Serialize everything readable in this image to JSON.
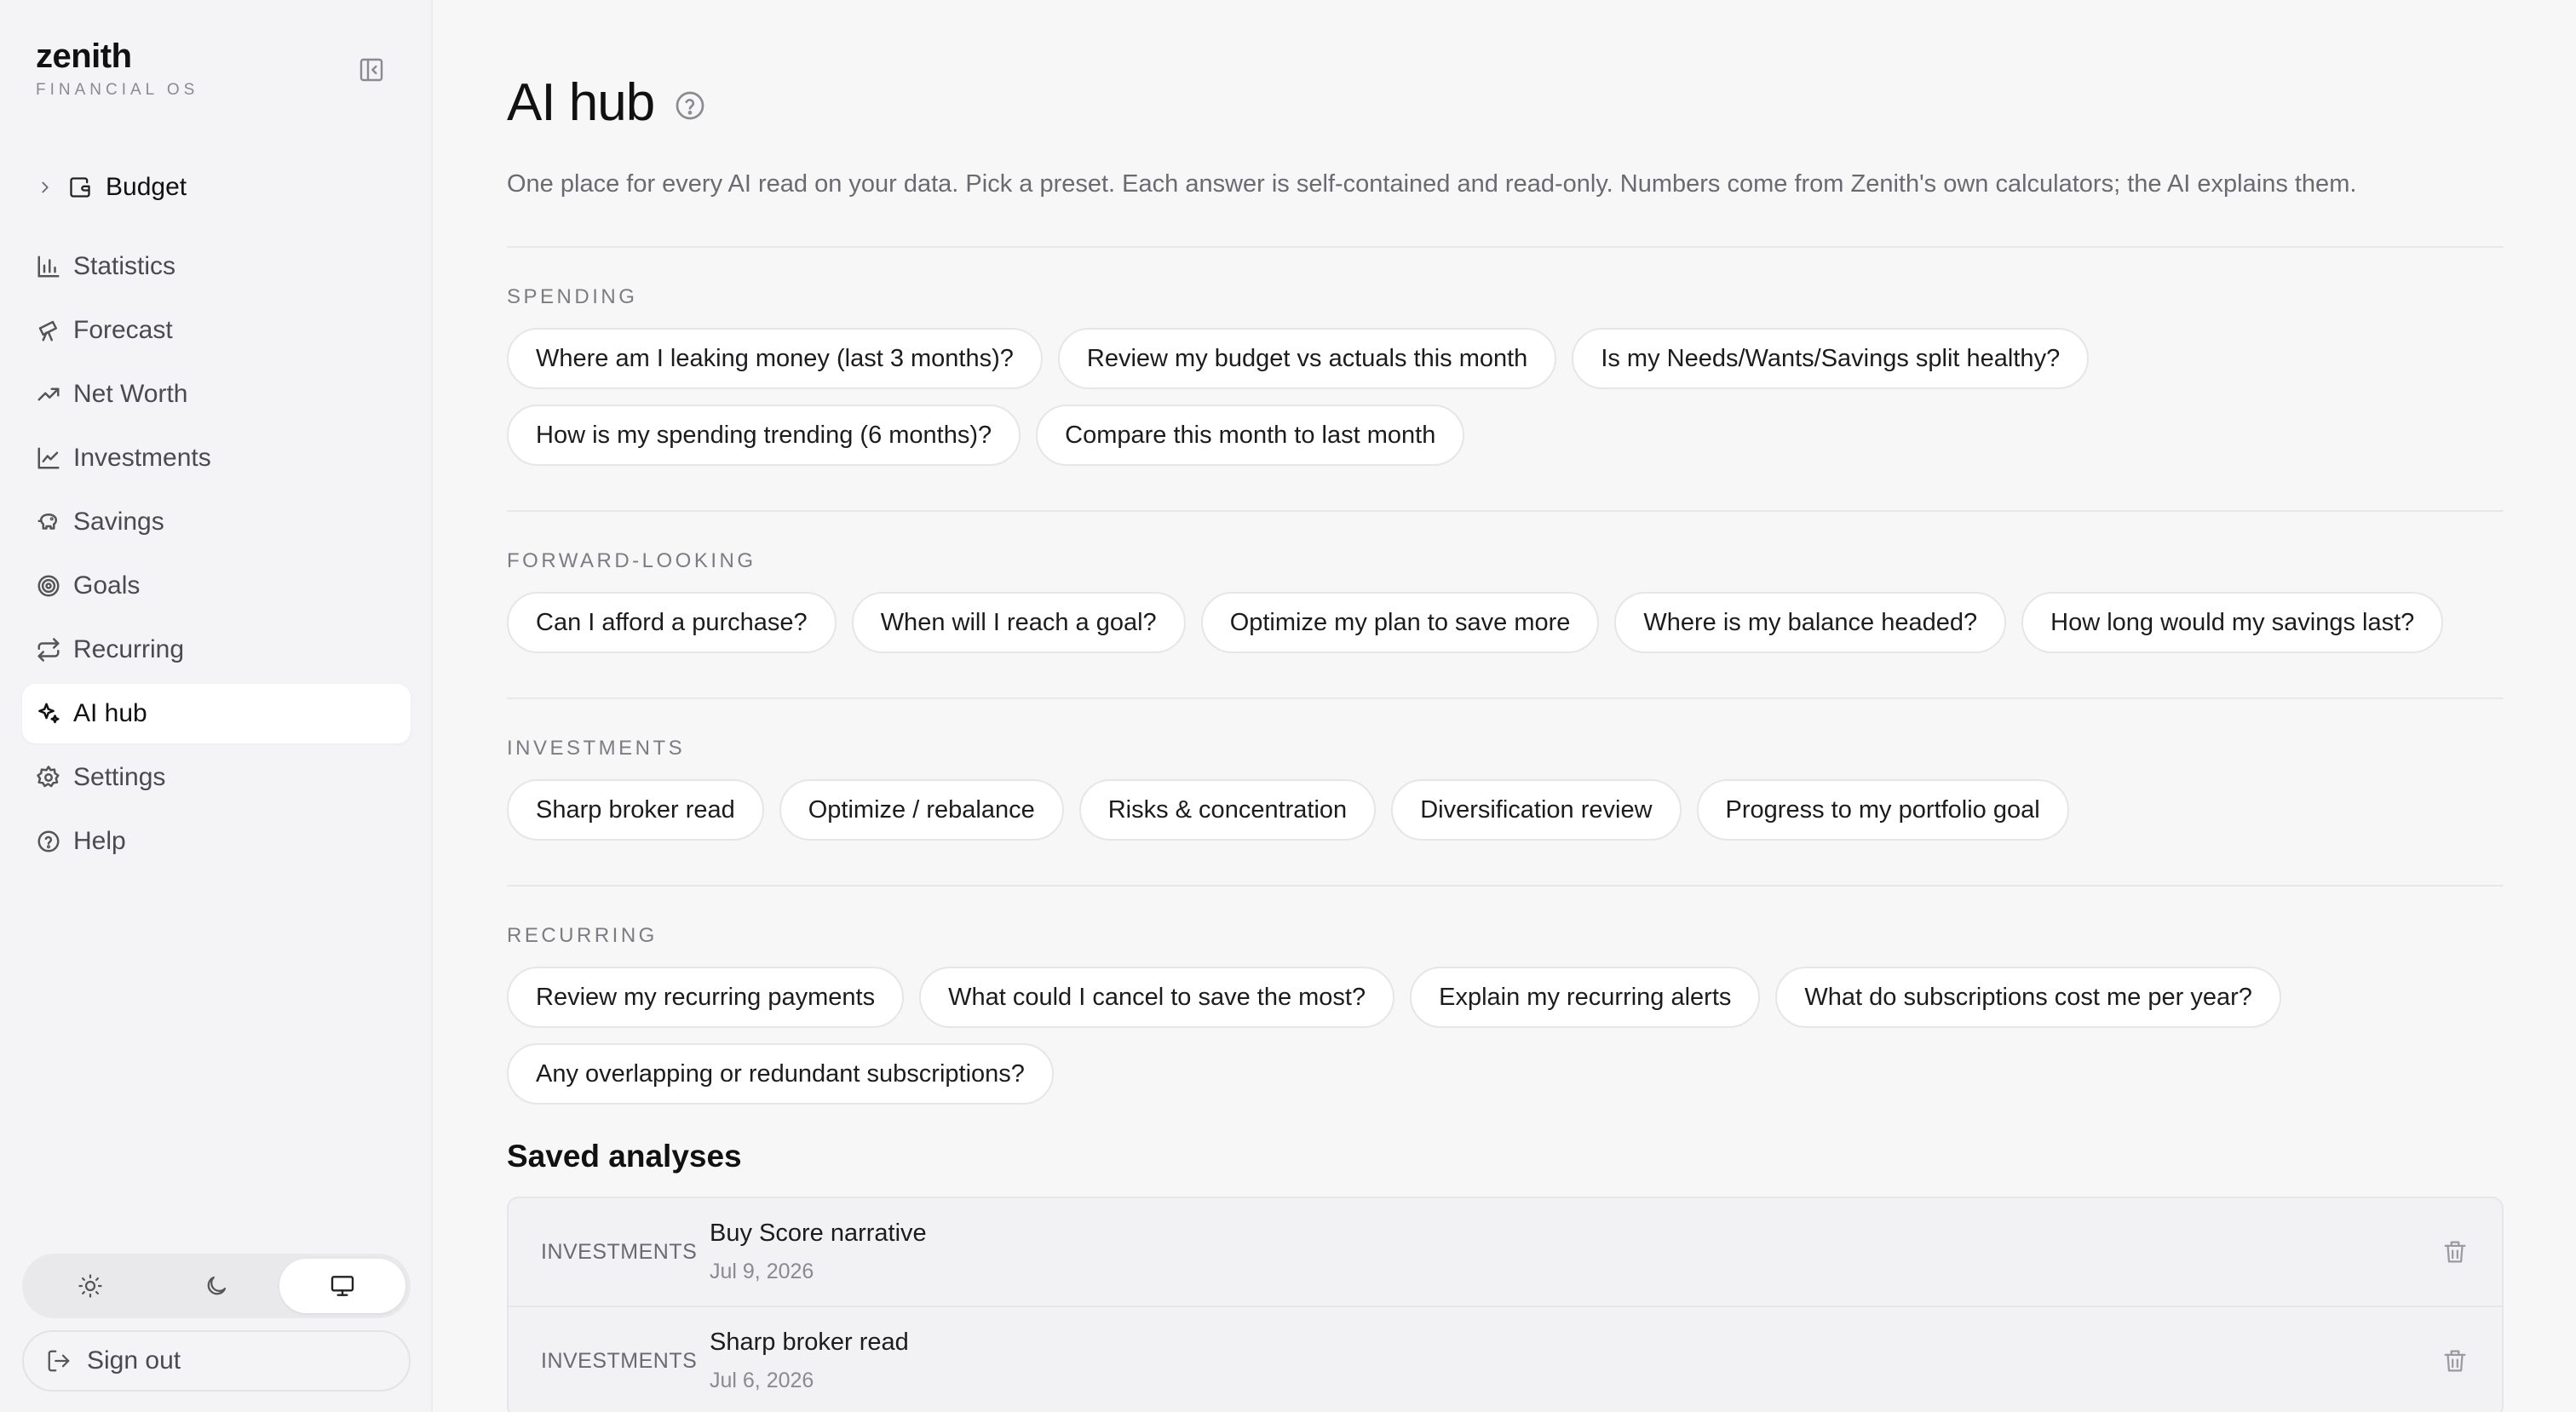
{
  "brand": {
    "name": "zenith",
    "subtitle": "FINANCIAL OS"
  },
  "sidebar": {
    "budget_label": "Budget",
    "items": [
      {
        "label": "Statistics",
        "icon": "bar-chart-icon"
      },
      {
        "label": "Forecast",
        "icon": "telescope-icon"
      },
      {
        "label": "Net Worth",
        "icon": "trending-up-icon"
      },
      {
        "label": "Investments",
        "icon": "line-chart-icon"
      },
      {
        "label": "Savings",
        "icon": "piggy-bank-icon"
      },
      {
        "label": "Goals",
        "icon": "target-icon"
      },
      {
        "label": "Recurring",
        "icon": "repeat-icon"
      },
      {
        "label": "AI hub",
        "icon": "sparkles-icon",
        "active": true
      },
      {
        "label": "Settings",
        "icon": "gear-icon"
      },
      {
        "label": "Help",
        "icon": "help-circle-icon"
      }
    ],
    "theme": {
      "selected": "system",
      "options": [
        "light",
        "dark",
        "system"
      ]
    },
    "signout_label": "Sign out"
  },
  "main": {
    "title": "AI hub",
    "description": "One place for every AI read on your data. Pick a preset. Each answer is self-contained and read-only. Numbers come from Zenith's own calculators; the AI explains them.",
    "sections": [
      {
        "label": "SPENDING",
        "presets": [
          "Where am I leaking money (last 3 months)?",
          "Review my budget vs actuals this month",
          "Is my Needs/Wants/Savings split healthy?",
          "How is my spending trending (6 months)?",
          "Compare this month to last month"
        ]
      },
      {
        "label": "FORWARD-LOOKING",
        "presets": [
          "Can I afford a purchase?",
          "When will I reach a goal?",
          "Optimize my plan to save more",
          "Where is my balance headed?",
          "How long would my savings last?"
        ]
      },
      {
        "label": "INVESTMENTS",
        "presets": [
          "Sharp broker read",
          "Optimize / rebalance",
          "Risks & concentration",
          "Diversification review",
          "Progress to my portfolio goal"
        ]
      },
      {
        "label": "RECURRING",
        "presets": [
          "Review my recurring payments",
          "What could I cancel to save the most?",
          "Explain my recurring alerts",
          "What do subscriptions cost me per year?",
          "Any overlapping or redundant subscriptions?"
        ]
      }
    ],
    "saved_title": "Saved analyses",
    "saved": [
      {
        "category": "INVESTMENTS",
        "name": "Buy Score narrative",
        "date": "Jul 9, 2026"
      },
      {
        "category": "INVESTMENTS",
        "name": "Sharp broker read",
        "date": "Jul 6, 2026"
      }
    ]
  }
}
